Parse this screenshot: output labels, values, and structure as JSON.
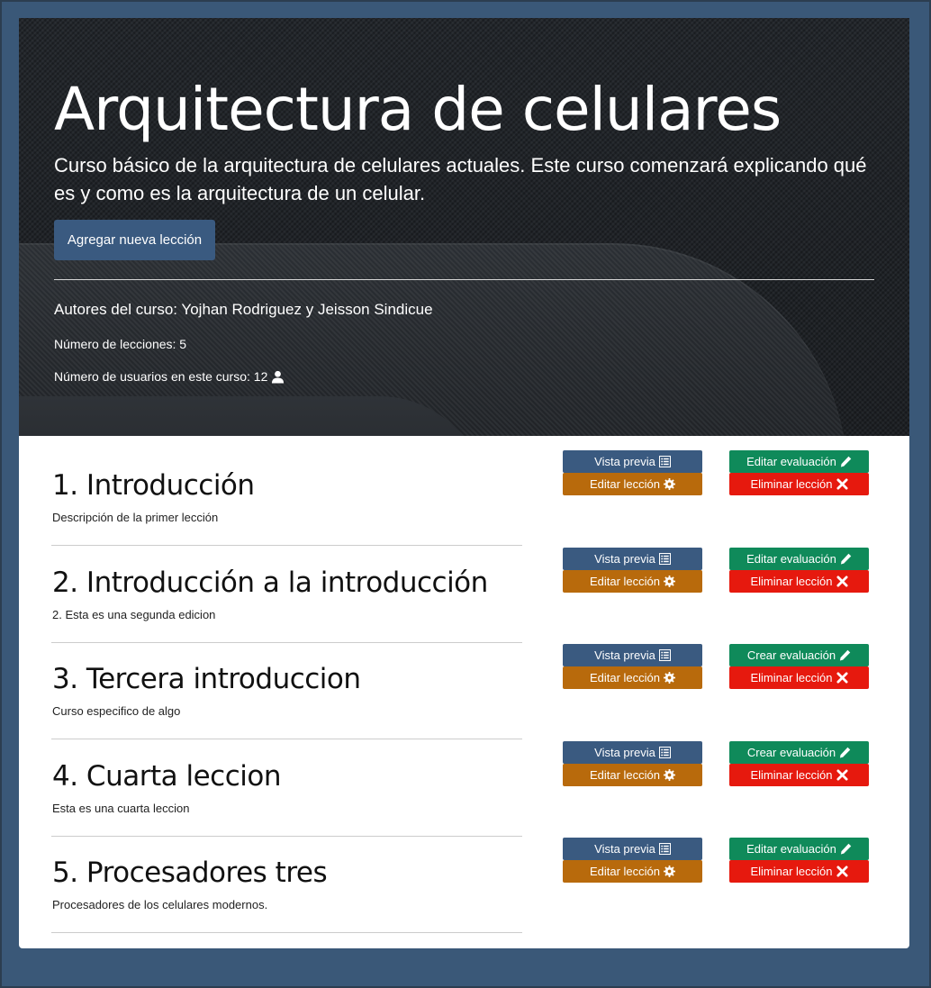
{
  "course": {
    "title": "Arquitectura de celulares",
    "description": "Curso básico de la arquitectura de celulares actuales. Este curso comenzará explicando qué es y como es la arquitectura de un celular.",
    "add_lesson_label": "Agregar nueva lección",
    "authors": "Autores del curso: Yojhan Rodriguez y Jeisson Sindicue",
    "lesson_count": "Número de lecciones: 5",
    "user_count": "Número de usuarios en este curso: 12"
  },
  "lessons": [
    {
      "title": "1. Introducción",
      "description": "Descripción de la primer lección",
      "preview": "Vista previa",
      "edit": "Editar lección",
      "evaluation": "Editar evaluación",
      "delete": "Eliminar lección"
    },
    {
      "title": "2. Introducción a la introducción",
      "description": "2. Esta es una segunda edicion",
      "preview": "Vista previa",
      "edit": "Editar lección",
      "evaluation": "Editar evaluación",
      "delete": "Eliminar lección"
    },
    {
      "title": "3. Tercera introduccion",
      "description": "Curso especifico de algo",
      "preview": "Vista previa",
      "edit": "Editar lección",
      "evaluation": "Crear evaluación",
      "delete": "Eliminar lección"
    },
    {
      "title": "4. Cuarta leccion",
      "description": "Esta es una cuarta leccion",
      "preview": "Vista previa",
      "edit": "Editar lección",
      "evaluation": "Crear evaluación",
      "delete": "Eliminar lección"
    },
    {
      "title": "5. Procesadores tres",
      "description": "Procesadores de los celulares modernos.",
      "preview": "Vista previa",
      "edit": "Editar lección",
      "evaluation": "Editar evaluación",
      "delete": "Eliminar lección"
    }
  ],
  "icons": {
    "preview": "list-alt-icon",
    "edit": "cog-icon",
    "evaluation": "pencil-icon",
    "delete": "close-icon",
    "users": "user-icon"
  },
  "colors": {
    "page_bg": "#3a5878",
    "primary": "#3a5a80",
    "warning": "#b86a0c",
    "success": "#0f8a5a",
    "danger": "#e6190e"
  }
}
